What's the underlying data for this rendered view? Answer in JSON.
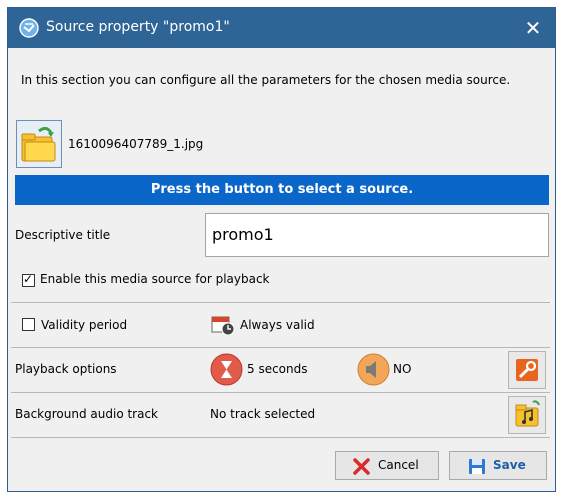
{
  "window": {
    "title": "Source property \"promo1\"",
    "close_glyph": "✕"
  },
  "intro_text": "In this section you can configure all the parameters for the chosen media source.",
  "source": {
    "filename": "1610096407789_1.jpg",
    "select_banner": "Press the button to select a source."
  },
  "descriptive": {
    "label": "Descriptive title",
    "value": "promo1"
  },
  "enable_playback": {
    "label": "Enable this media source for playback",
    "checked": true
  },
  "validity": {
    "label": "Validity period",
    "checked": false,
    "value": "Always valid"
  },
  "playback_options": {
    "label": "Playback options",
    "duration": "5 seconds",
    "audio": "NO"
  },
  "background_audio": {
    "label": "Background audio track",
    "value": "No track selected"
  },
  "buttons": {
    "cancel": "Cancel",
    "save": "Save"
  },
  "colors": {
    "titlebar": "#2e6496",
    "banner": "#0a66c8",
    "accent_orange": "#e8651f"
  }
}
